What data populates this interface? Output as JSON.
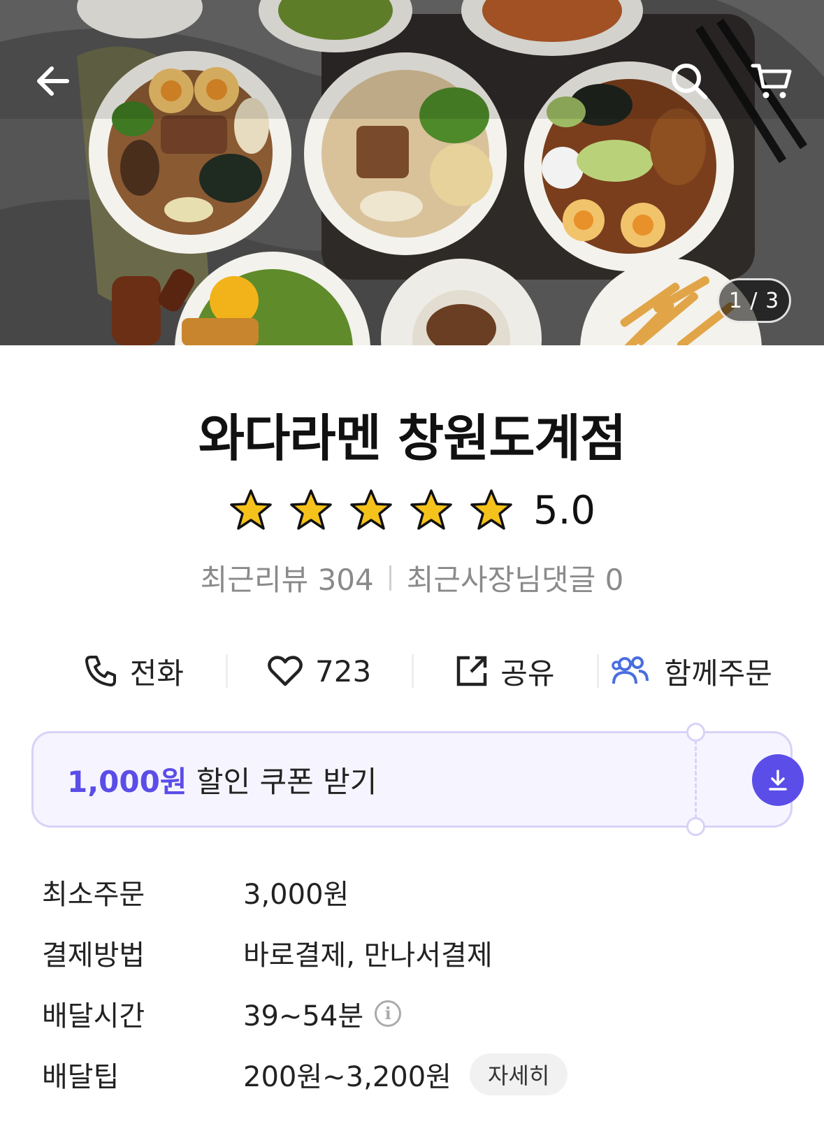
{
  "hero": {
    "image_counter": "1 / 3"
  },
  "store": {
    "name": "와다라멘 창원도계점",
    "rating": "5.0",
    "stars_filled": 5,
    "stars_total": 5,
    "recent_reviews": "최근리뷰 304",
    "owner_comments": "최근사장님댓글 0"
  },
  "actions": {
    "call": "전화",
    "likes": "723",
    "share": "공유",
    "group_order": "함께주문"
  },
  "coupon": {
    "amount": "1,000원",
    "label": " 할인 쿠폰 받기"
  },
  "info": [
    {
      "label": "최소주문",
      "value": "3,000원"
    },
    {
      "label": "결제방법",
      "value": "바로결제, 만나서결제"
    },
    {
      "label": "배달시간",
      "value": "39~54분"
    },
    {
      "label": "배달팁",
      "value": "200원~3,200원",
      "action": "자세히"
    }
  ],
  "colors": {
    "accent": "#5b4de8",
    "coupon_bg": "#f6f5ff",
    "star": "#f5c21b"
  },
  "icons": {
    "back": "arrow-left-icon",
    "search": "search-icon",
    "cart": "cart-icon",
    "call": "phone-icon",
    "like": "heart-icon",
    "share": "share-icon",
    "group": "people-icon",
    "download": "download-icon",
    "info": "info-icon"
  }
}
